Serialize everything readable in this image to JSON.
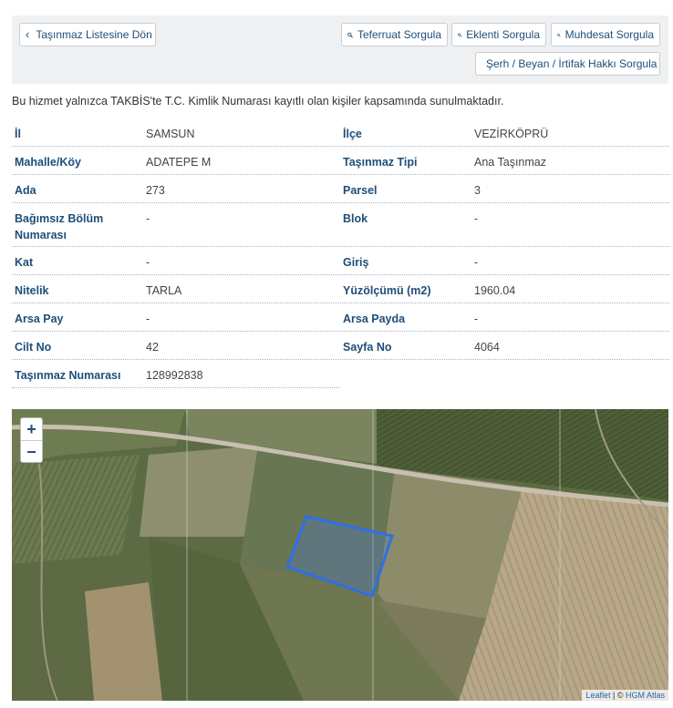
{
  "toolbar": {
    "back_label": "Taşınmaz Listesine Dön",
    "buttons": [
      {
        "label": "Teferruat Sorgula"
      },
      {
        "label": "Eklenti Sorgula"
      },
      {
        "label": "Muhdesat Sorgula"
      },
      {
        "label": "Şerh / Beyan / İrtifak Hakkı Sorgula"
      }
    ]
  },
  "notice": "Bu hizmet yalnızca TAKBİS'te T.C. Kimlik Numarası kayıtlı olan kişiler kapsamında sunulmaktadır.",
  "fields": {
    "il": {
      "label": "İl",
      "value": "SAMSUN"
    },
    "ilce": {
      "label": "İlçe",
      "value": "VEZİRKÖPRÜ"
    },
    "mahalle": {
      "label": "Mahalle/Köy",
      "value": "ADATEPE M"
    },
    "tasinmaz_tipi": {
      "label": "Taşınmaz Tipi",
      "value": "Ana Taşınmaz"
    },
    "ada": {
      "label": "Ada",
      "value": "273"
    },
    "parsel": {
      "label": "Parsel",
      "value": "3"
    },
    "bagimsiz_bolum": {
      "label": "Bağımsız Bölüm Numarası",
      "value": "-"
    },
    "blok": {
      "label": "Blok",
      "value": "-"
    },
    "kat": {
      "label": "Kat",
      "value": "-"
    },
    "giris": {
      "label": "Giriş",
      "value": "-"
    },
    "nitelik": {
      "label": "Nitelik",
      "value": "TARLA"
    },
    "yuzolcumu": {
      "label": "Yüzölçümü (m2)",
      "value": "1960.04"
    },
    "arsa_pay": {
      "label": "Arsa Pay",
      "value": "-"
    },
    "arsa_payda": {
      "label": "Arsa Payda",
      "value": "-"
    },
    "cilt_no": {
      "label": "Cilt No",
      "value": "42"
    },
    "sayfa_no": {
      "label": "Sayfa No",
      "value": "4064"
    },
    "tasinmaz_no": {
      "label": "Taşınmaz Numarası",
      "value": "128992838"
    }
  },
  "map": {
    "zoom_in": "+",
    "zoom_out": "−",
    "attribution_leaflet": "Leaflet",
    "attribution_sep": " | © ",
    "attribution_source": "HGM Atlas",
    "parcel_color": "#2f6fe6"
  },
  "colors": {
    "label": "#1f4e79",
    "toolbar_bg": "#eef0f2"
  }
}
